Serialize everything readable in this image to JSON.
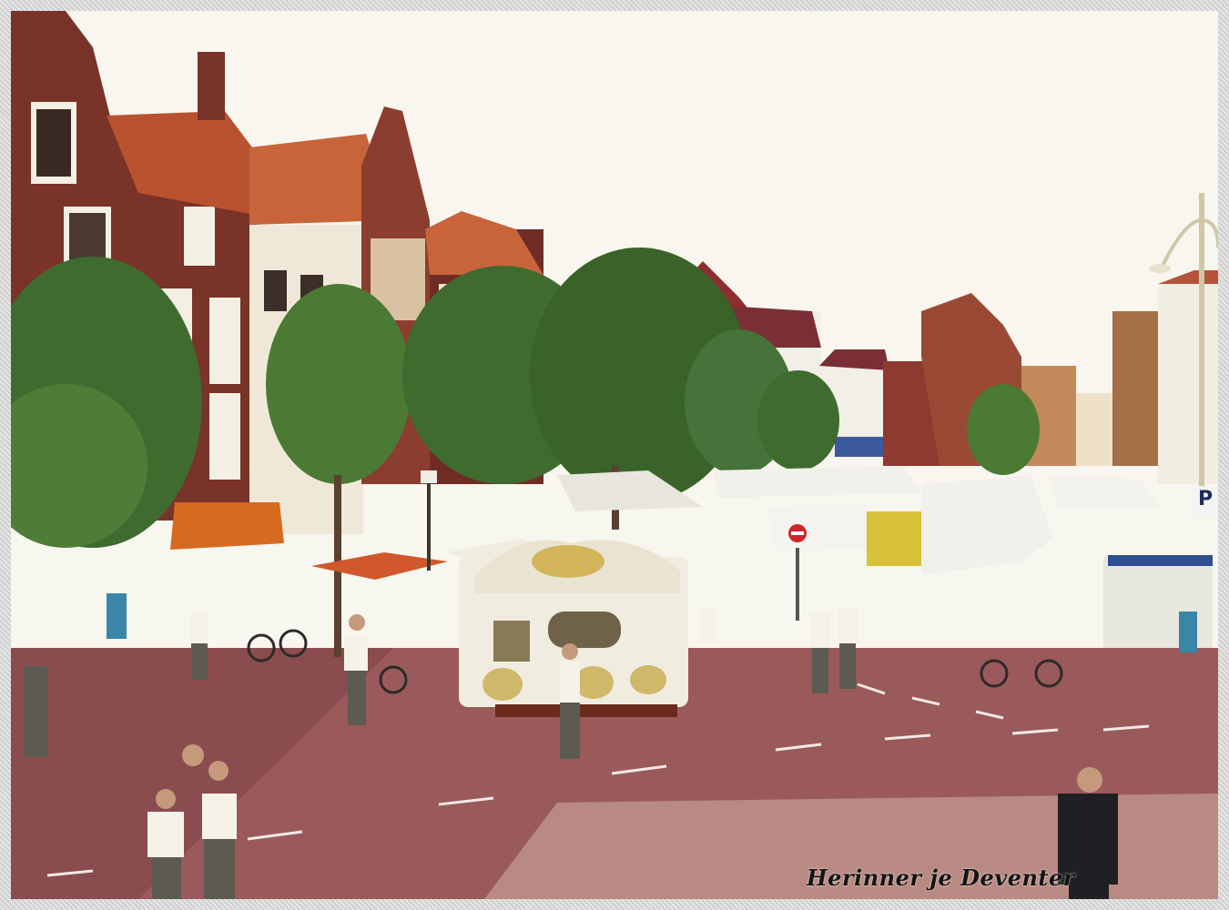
{
  "photo": {
    "subject": "town-square-street-organ-market",
    "colors": {
      "sky": "#f8f6ee",
      "pavement": "#9a5a5b",
      "pavement_dark": "#7f4446",
      "brick": "#7a3328",
      "roof": "#c8643a",
      "tree": "#3f6b2f",
      "organ": "#f1ece0",
      "awning": "#d66a1f",
      "market_tent": "#f1f0ea"
    }
  },
  "caption": {
    "text": "Herinner je Deventer"
  },
  "signs": {
    "parking": "P"
  }
}
